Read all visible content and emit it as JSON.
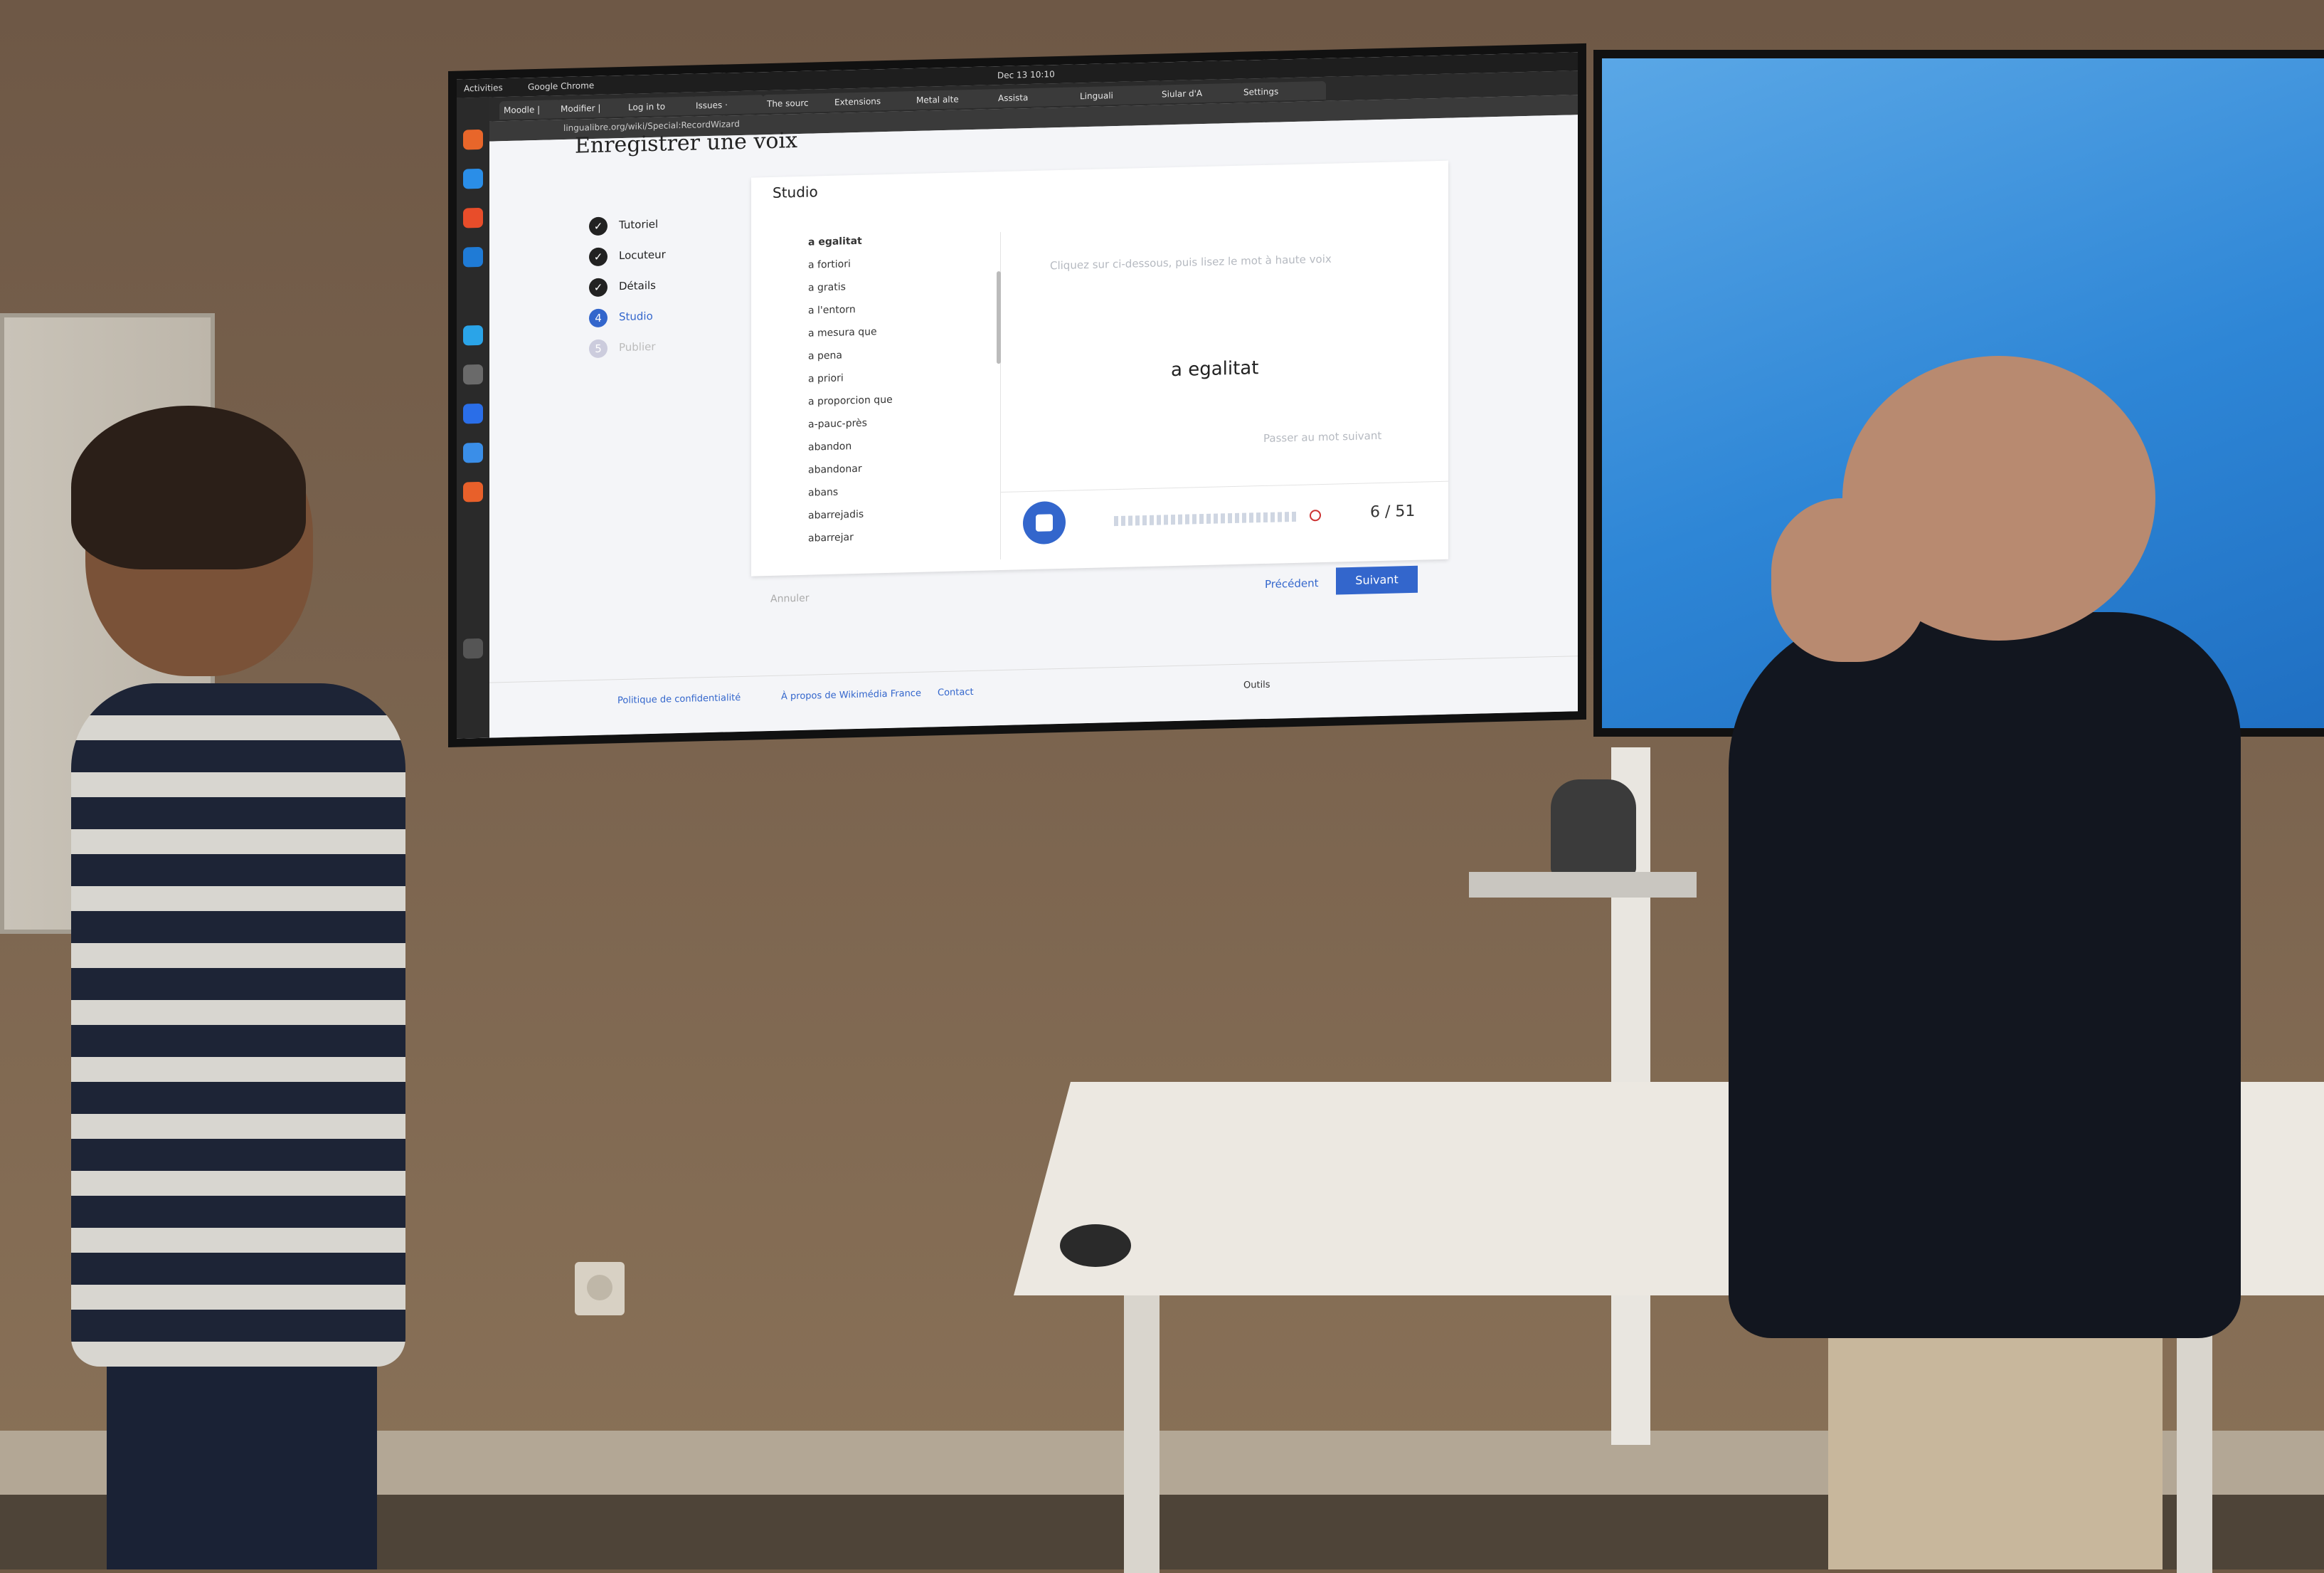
{
  "os_bar": {
    "app": "Google Chrome",
    "activities": "Activities",
    "clock": "Dec 13  10:10"
  },
  "browser": {
    "tabs": [
      "Moodle |",
      "Modifier |",
      "Log in to",
      "Issues ·",
      "The sourc",
      "Extensions",
      "Metal alte",
      "Assista",
      "Linguali",
      "Siular d'A",
      "Settings"
    ],
    "url": "lingualibre.org/wiki/Special:RecordWizard"
  },
  "page": {
    "title": "Enregistrer une voix",
    "steps": [
      {
        "num": "✓",
        "label": "Tutoriel"
      },
      {
        "num": "✓",
        "label": "Locuteur"
      },
      {
        "num": "✓",
        "label": "Détails"
      },
      {
        "num": "4",
        "label": "Studio"
      },
      {
        "num": "5",
        "label": "Publier"
      }
    ],
    "studio": {
      "heading": "Studio",
      "words": [
        "a egalitat",
        "a fortiori",
        "a gratis",
        "a l'entorn",
        "a mesura que",
        "a pena",
        "a priori",
        "a proporcion que",
        "a-pauc-près",
        "abandon",
        "abandonar",
        "abans",
        "abarrejadis",
        "abarrejar"
      ],
      "hint": "Cliquez sur  ci-dessous, puis lisez le mot à haute voix",
      "current_word": "a egalitat",
      "skip": "Passer au mot suivant",
      "progress": "6 / 51"
    },
    "nav": {
      "cancel": "Annuler",
      "prev": "Précédent",
      "next": "Suivant"
    },
    "footer": {
      "privacy": "Politique de confidentialité",
      "about": "À propos de Wikimédia France",
      "contact": "Contact",
      "tools": "Outils"
    }
  }
}
